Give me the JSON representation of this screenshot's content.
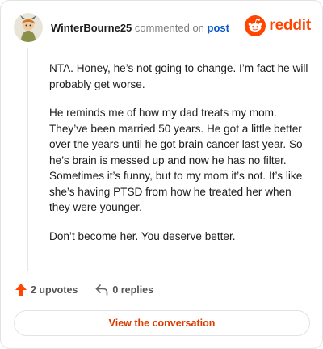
{
  "comment": {
    "username": "WinterBourne25",
    "action_text": "commented on",
    "post_link": "post",
    "brand": "reddit",
    "paragraphs": [
      "NTA. Honey, he’s not going to change. I’m fact he will probably get worse.",
      "He reminds me of how my dad treats my mom. They’ve been married 50 years. He got a little better over the years until he got brain cancer last year. So he’s brain is messed up and now he has no filter. Sometimes it’s funny, but to my mom it’s not. It’s like she’s having PTSD from how he treated her when they were younger.",
      "Don’t become her. You deserve better."
    ]
  },
  "actions": {
    "upvotes_label": "2 upvotes",
    "replies_label": "0 replies",
    "upvote_icon": "upvote-arrow-icon",
    "reply_icon": "reply-arrow-icon"
  },
  "footer": {
    "view_button_label": "View the conversation"
  },
  "colors": {
    "brand": "#ff4500",
    "link": "#0a58ca",
    "button_text": "#d93a00"
  }
}
